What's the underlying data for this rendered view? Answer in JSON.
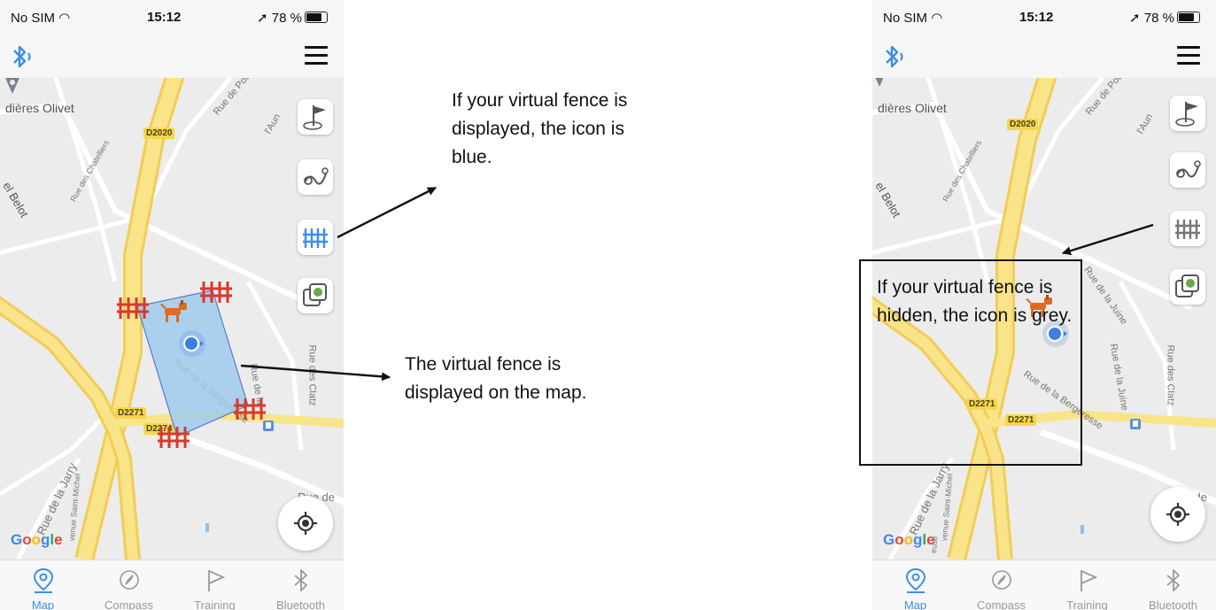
{
  "status": {
    "sim": "No SIM",
    "time": "15:12",
    "battery": "78 %"
  },
  "map": {
    "place_olivet": "dières Olivet",
    "belot": "el Belot",
    "rue_poun": "Rue de Poun",
    "rue_aun": "l'Aun",
    "rue_chatelliers": "Rue des Chatelliers",
    "rue_bergeresse": "Rue de la Bergeresse",
    "rue_la": "Rue de la",
    "rue_juine": "Rue de la Juine",
    "rue_clatz": "Rue des Clatz",
    "rue_jarry": "Rue de la Jarry",
    "avenue_saint_michel": "venue Saint-Michel",
    "meuse": "euse",
    "rue_de": "Rue de",
    "d2020": "D2020",
    "d2271": "D2271",
    "d2271b": "D2274",
    "google": {
      "g1": "G",
      "o1": "o",
      "o2": "o",
      "g2": "g",
      "l": "l",
      "e": "e"
    }
  },
  "tabs": [
    {
      "label": "Map",
      "icon": "map-pin-icon"
    },
    {
      "label": "Compass",
      "icon": "compass-icon"
    },
    {
      "label": "Training",
      "icon": "flag-icon"
    },
    {
      "label": "Bluetooth",
      "icon": "bluetooth-icon"
    }
  ],
  "annotations": {
    "fence_icon_blue": "If your virtual fence is displayed, the icon is blue.",
    "fence_on_map": "The virtual fence is displayed on the map.",
    "fence_icon_grey": "If your virtual fence is hidden, the icon is grey."
  },
  "colors": {
    "accent": "#3c8ee8",
    "fence": "#d83a2a",
    "road": "#f4d64e",
    "fence_area": "#9fcbef"
  }
}
